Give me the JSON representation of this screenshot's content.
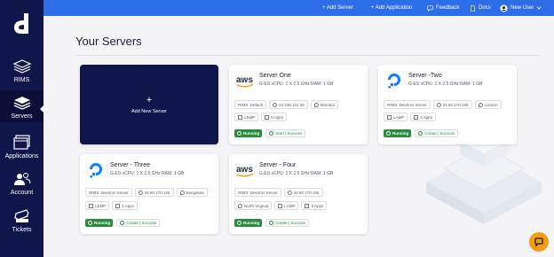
{
  "topbar": {
    "add_server": "+ Add Server",
    "add_application": "+ Add Application",
    "feedback": "Feedback",
    "docs": "Docs",
    "user": "New User"
  },
  "sidebar": {
    "items": [
      {
        "label": "RIMS",
        "icon": "stack-icon"
      },
      {
        "label": "Servers",
        "icon": "server-layers-icon"
      },
      {
        "label": "Applications",
        "icon": "window-icon"
      },
      {
        "label": "Account",
        "icon": "users-icon"
      },
      {
        "label": "Tickets",
        "icon": "ticket-icon"
      }
    ]
  },
  "page": {
    "title": "Your Servers"
  },
  "add_card": {
    "plus": "+",
    "label": "Add New Server"
  },
  "servers": [
    {
      "name": "Server One",
      "provider": "aws",
      "spec": "G-ES  vCPU: 1 X 2.5 GHz  RAM: 1 GB",
      "tags": [
        "RIMS: Default",
        "13.235.131.35",
        "Mumbai",
        "LEMP",
        "6 Apps"
      ],
      "status": "Running",
      "action": "Start | Success"
    },
    {
      "name": "Server -Two",
      "provider": "digitalocean",
      "spec": "G-ES  vCPU: 1 X 2.5 GHz  RAM: 1 GB",
      "tags": [
        "RIMS: Devrims Server",
        "34.80.170.155",
        "London",
        "LAMP",
        "3 Apps"
      ],
      "status": "Running",
      "action": "Create | Success"
    },
    {
      "name": "Server - Three",
      "provider": "digitalocean",
      "spec": "G-ES  vCPU: 1 X 2.5 GHz  RAM: 1 GB",
      "tags": [
        "RIMS: Devrims Server",
        "34.80.170.155",
        "Bangalore",
        "LEMP",
        "2 Apps"
      ],
      "status": "Running",
      "action": "Create | Success"
    },
    {
      "name": "Server - Four",
      "provider": "aws",
      "spec": "G-ES  vCPU: 1 X 2.5 GHz  RAM: 1 GB",
      "tags": [
        "RIMS: Devrims Server",
        "34.80.170.155",
        "North Virginia",
        "LAMP",
        "3 Apps"
      ],
      "status": "Running",
      "action": "Create | Success"
    }
  ],
  "colors": {
    "sidebar": "#10154a",
    "topbar": "#2d6ee8",
    "running": "#2a8a3e",
    "chat": "#f29d14"
  }
}
